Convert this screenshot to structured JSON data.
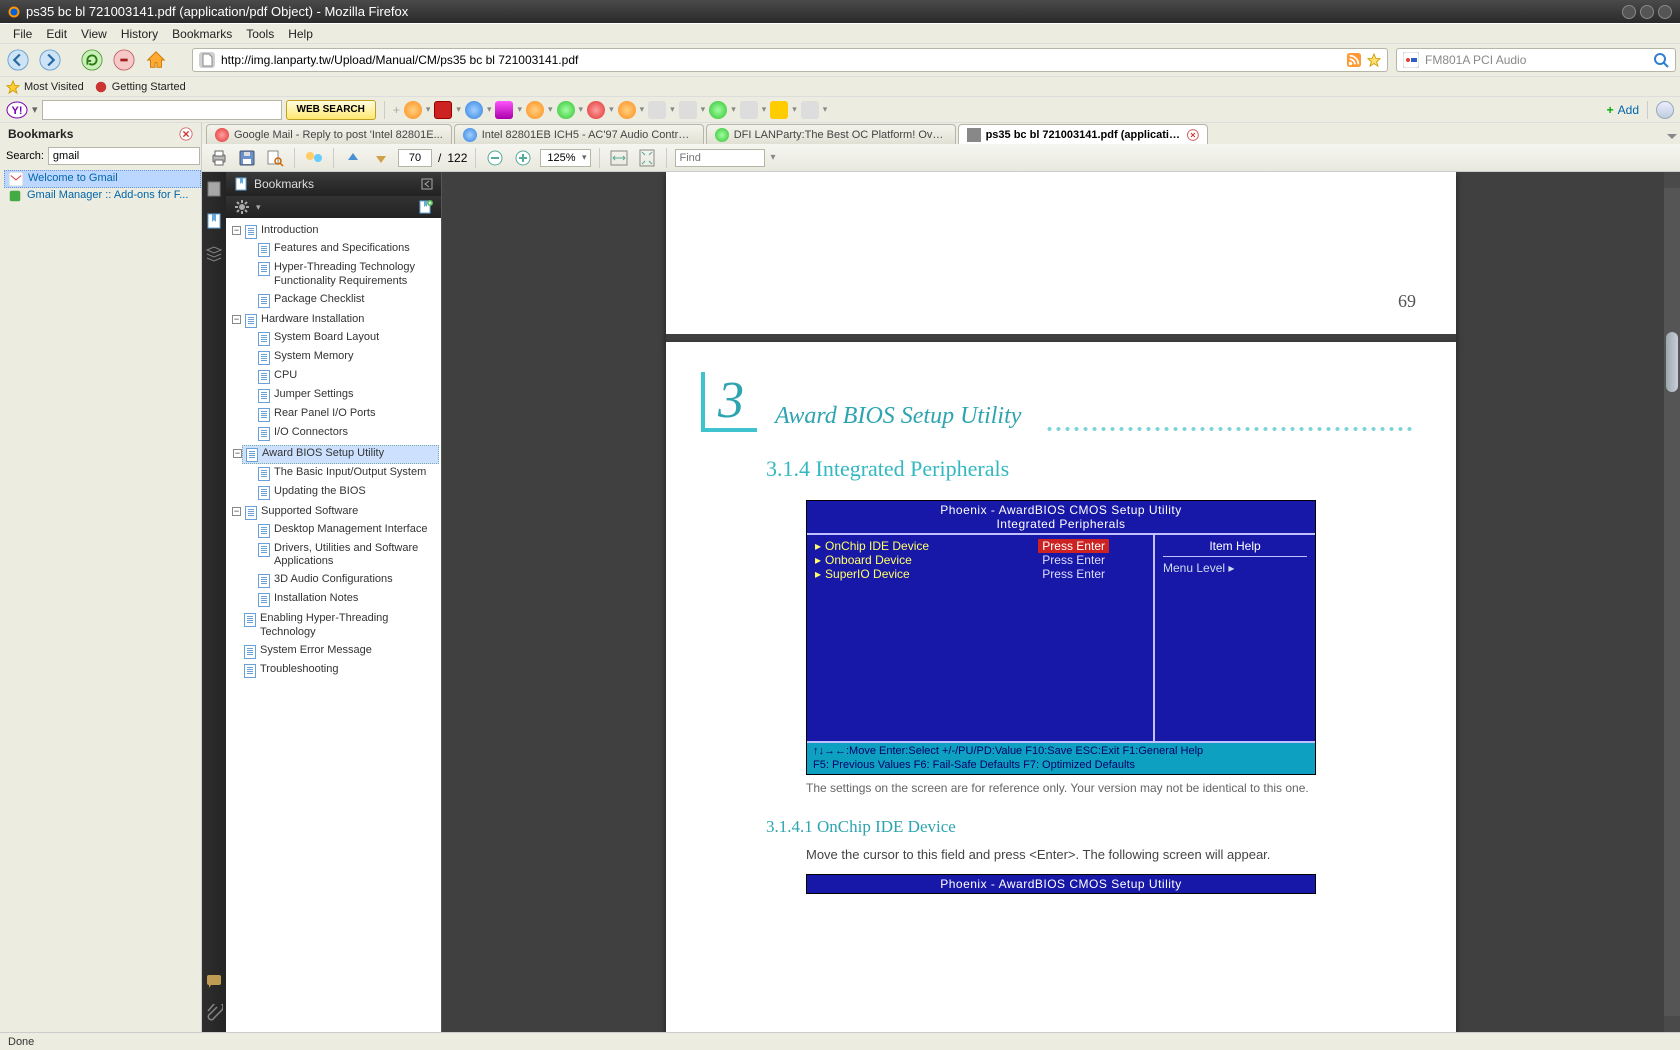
{
  "window": {
    "title": "ps35 bc bl 721003141.pdf (application/pdf Object) - Mozilla Firefox"
  },
  "menu": {
    "file": "File",
    "edit": "Edit",
    "view": "View",
    "history": "History",
    "bookmarks": "Bookmarks",
    "tools": "Tools",
    "help": "Help"
  },
  "url": "http://img.lanparty.tw/Upload/Manual/CM/ps35 bc bl 721003141.pdf",
  "search_engine": "FM801A PCI Audio",
  "bm_toolbar": {
    "most": "Most Visited",
    "getting": "Getting Started"
  },
  "ytoolbar": {
    "websearch": "WEB SEARCH",
    "add": "Add"
  },
  "sidebar": {
    "title": "Bookmarks",
    "search_label": "Search:",
    "search_value": "gmail",
    "items": [
      {
        "label": "Welcome to Gmail",
        "selected": true
      },
      {
        "label": "Gmail Manager :: Add-ons for F..."
      }
    ]
  },
  "tabs": [
    {
      "label": "Google Mail - Reply to post 'Intel 82801E..."
    },
    {
      "label": "Intel 82801EB ICH5 - AC'97 Audio Control..."
    },
    {
      "label": "DFI LANParty:The Best OC Platform! Ove..."
    },
    {
      "label": "ps35 bc bl 721003141.pdf (applicatio...",
      "active": true
    }
  ],
  "pdf_toolbar": {
    "page": "70",
    "pages": "122",
    "zoom": "125%",
    "find_ph": "Find"
  },
  "pdf_bookmarks_title": "Bookmarks",
  "pdf_tree": {
    "n1": "Introduction",
    "n1a": "Features and Specifications",
    "n1b": "Hyper-Threading Technology Functionality Requirements",
    "n1c": "Package Checklist",
    "n2": "Hardware Installation",
    "n2a": "System Board Layout",
    "n2b": "System Memory",
    "n2c": "CPU",
    "n2d": "Jumper Settings",
    "n2e": "Rear Panel I/O Ports",
    "n2f": "I/O Connectors",
    "n3": "Award BIOS Setup Utility",
    "n3a": "The Basic Input/Output System",
    "n3b": "Updating the BIOS",
    "n4": "Supported Software",
    "n4a": "Desktop Management Interface",
    "n4b": "Drivers, Utilities and Software Applications",
    "n4c": "3D Audio Configurations",
    "n4d": "Installation Notes",
    "n5": "Enabling Hyper-Threading Technology",
    "n6": "System Error Message",
    "n7": "Troubleshooting"
  },
  "doc": {
    "prev_page": "69",
    "chapter_num": "3",
    "chapter_title": "Award BIOS Setup Utility",
    "sec": "3.1.4  Integrated Peripherals",
    "bios_hdr1": "Phoenix - AwardBIOS CMOS Setup Utility",
    "bios_hdr2": "Integrated Peripherals",
    "rows": [
      {
        "k": "OnChip IDE Device",
        "v": "Press Enter",
        "sel": true
      },
      {
        "k": "Onboard Device",
        "v": "Press Enter"
      },
      {
        "k": "SuperIO Device",
        "v": "Press Enter"
      }
    ],
    "item_help": "Item Help",
    "menu_level": "Menu Level    ▸",
    "footer1": "↑↓→←:Move  Enter:Select  +/-/PU/PD:Value  F10:Save  ESC:Exit  F1:General Help",
    "footer2": "F5: Previous Values    F6: Fail-Safe Defaults    F7: Optimized Defaults",
    "note": "The settings on the screen are for reference only. Your version may not be identical to this one.",
    "subsec": "3.1.4.1  OnChip IDE Device",
    "body": "Move the cursor to this field and press <Enter>. The following screen will appear.",
    "bios2_hdr1": "Phoenix - AwardBIOS CMOS Setup Utility"
  },
  "status": "Done"
}
